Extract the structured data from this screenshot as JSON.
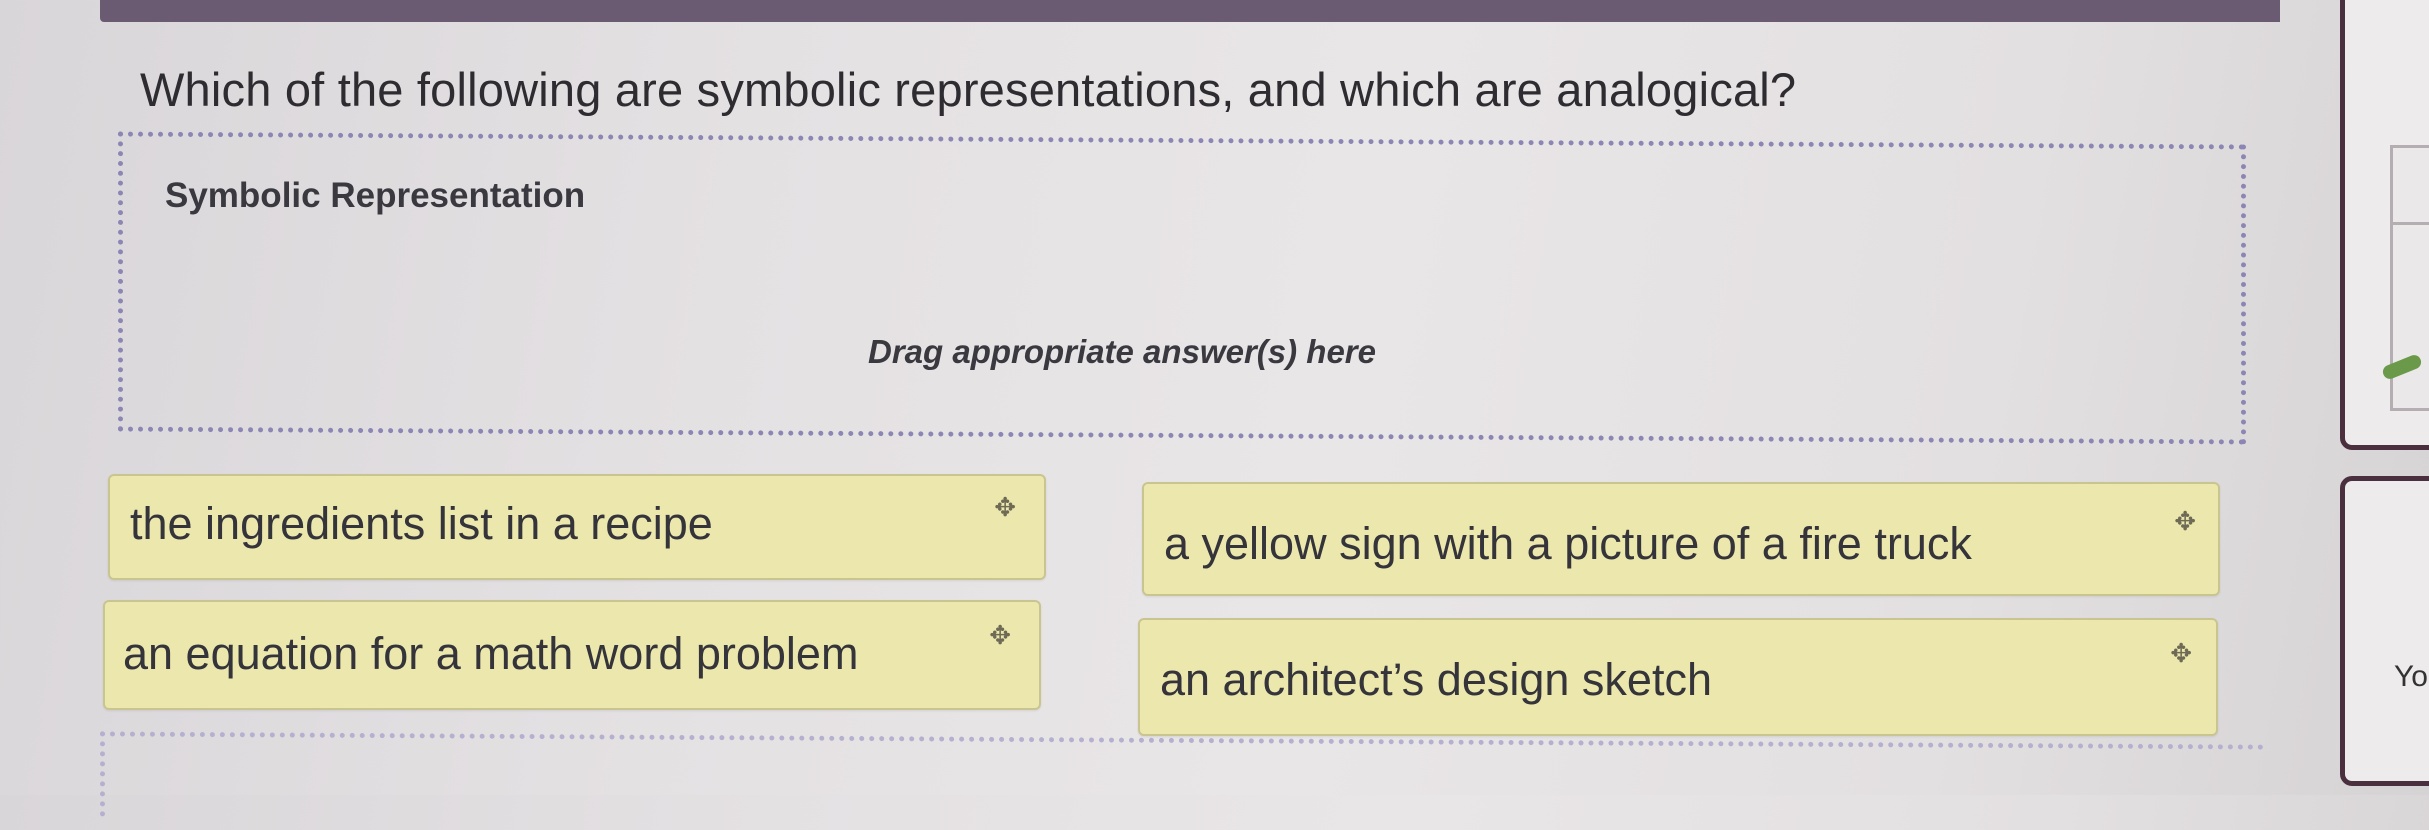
{
  "question": "Which of the following are symbolic representations, and which are analogical?",
  "drop_zone": {
    "title": "Symbolic Representation",
    "hint": "Drag appropriate answer(s) here"
  },
  "answer_tiles": [
    {
      "label": "the ingredients list in a recipe",
      "icon": "move-icon"
    },
    {
      "label": "a yellow sign with a picture of a fire truck",
      "icon": "move-icon"
    },
    {
      "label": "an equation for a math word problem",
      "icon": "move-icon"
    },
    {
      "label": "an architect’s design sketch",
      "icon": "move-icon"
    }
  ],
  "side_panel": {
    "text": "Yo"
  },
  "colors": {
    "tile_background": "#ece8ad",
    "dropzone_border": "#8c86b5",
    "header_bar": "#6a5a72",
    "side_panel_border": "#4a2f3e",
    "side_accent": "#6a9a49"
  }
}
